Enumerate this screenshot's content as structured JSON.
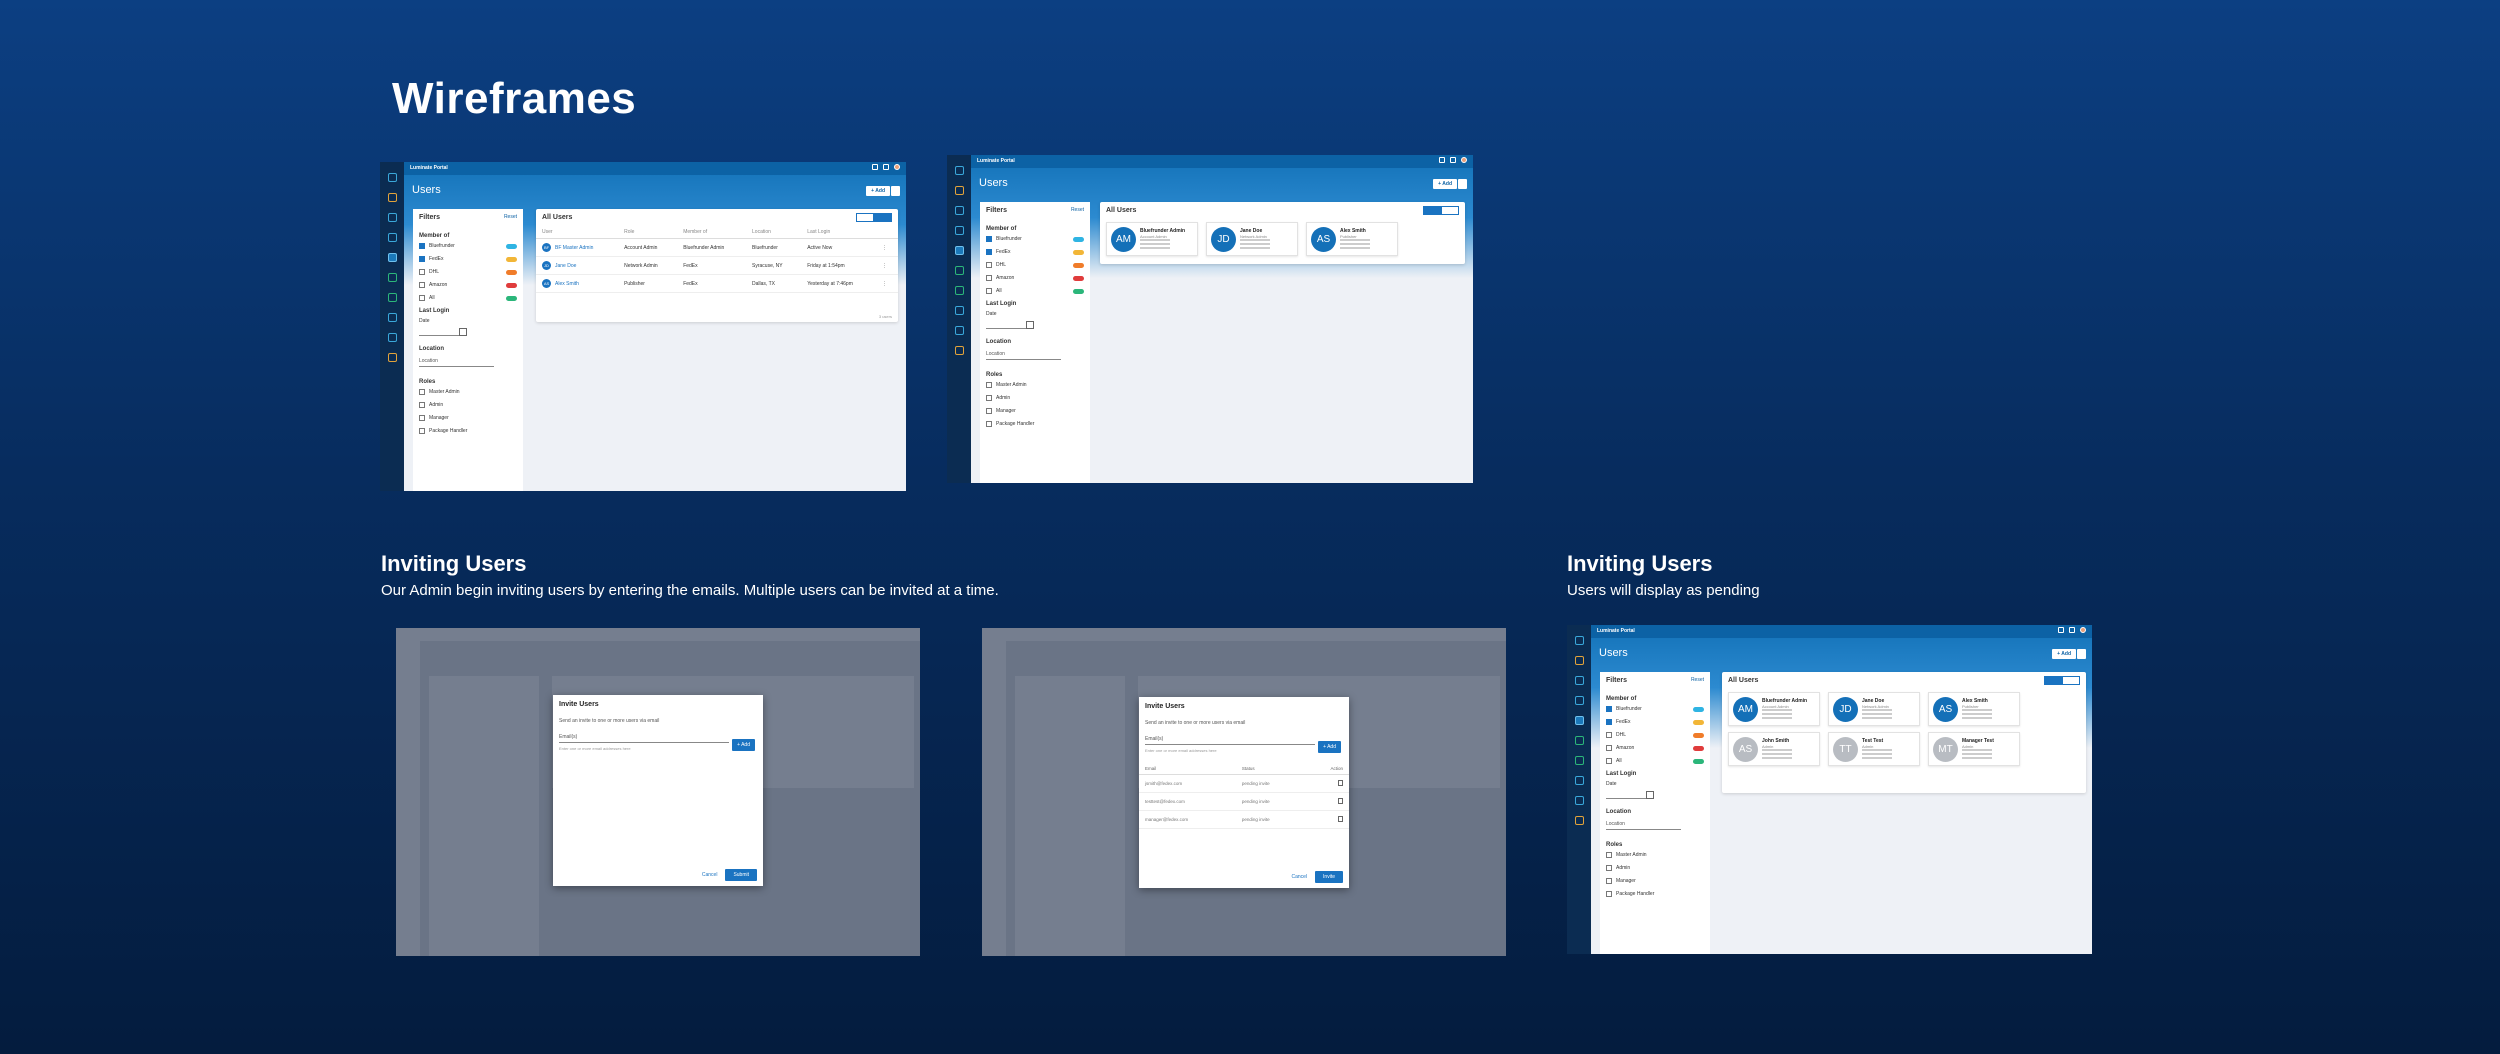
{
  "page": {
    "title": "Wireframes"
  },
  "sections": {
    "inviting_left": {
      "title": "Inviting Users",
      "subtitle": "Our Admin begin inviting users by entering the emails. Multiple users can be invited at a time."
    },
    "inviting_right": {
      "title": "Inviting Users",
      "subtitle": "Users will display as pending"
    }
  },
  "app": {
    "name": "Luminate Portal",
    "page_heading": "Users",
    "add_label": "+ Add",
    "filters": {
      "title": "Filters",
      "reset": "Reset",
      "member_of": "Member of",
      "members": [
        {
          "label": "Bluefrunder",
          "checked": true,
          "color": "#2fb4e3"
        },
        {
          "label": "FedEx",
          "checked": true,
          "color": "#f2b637"
        },
        {
          "label": "DHL",
          "checked": false,
          "color": "#f07c2a"
        },
        {
          "label": "Amazon",
          "checked": false,
          "color": "#e03c3c"
        },
        {
          "label": "All",
          "checked": false,
          "color": "#2bb67a"
        }
      ],
      "last_login": "Last Login",
      "date_label": "Date",
      "location": "Location",
      "location_placeholder": "Location",
      "roles": "Roles",
      "role_items": [
        "Master Admin",
        "Admin",
        "Manager",
        "Package Handler"
      ]
    },
    "all_users": "All Users",
    "table": {
      "columns": [
        "User",
        "Role",
        "Member of",
        "Location",
        "Last Login"
      ],
      "rows": [
        {
          "initials": "BF",
          "user": "BF Master Admin",
          "role": "Account Admin",
          "member": "Bluefrunder Admin",
          "location": "Bluefrunder",
          "last": "Active Now"
        },
        {
          "initials": "JD",
          "user": "Jane Doe",
          "role": "Network Admin",
          "member": "FedEx",
          "location": "Syracuse, NY",
          "last": "Friday at 1:54pm"
        },
        {
          "initials": "AS",
          "user": "Alex Smith",
          "role": "Publisher",
          "member": "FedEx",
          "location": "Dallas, TX",
          "last": "Yesterday at 7:46pm"
        }
      ],
      "footer": "3 users"
    },
    "cards": [
      {
        "initials": "AM",
        "name": "Bluefrunder Admin",
        "role": "Account Admin",
        "pending": false
      },
      {
        "initials": "JD",
        "name": "Jane Doe",
        "role": "Network Admin",
        "pending": false
      },
      {
        "initials": "AS",
        "name": "Alex Smith",
        "role": "Publisher",
        "pending": false
      }
    ],
    "cards_pending": [
      {
        "initials": "AS",
        "name": "John Smith",
        "role": "Admin",
        "pending": true
      },
      {
        "initials": "TT",
        "name": "Test Test",
        "role": "Admin",
        "pending": true
      },
      {
        "initials": "MT",
        "name": "Manager Test",
        "role": "Admin",
        "pending": true
      }
    ]
  },
  "dialog": {
    "title": "Invite Users",
    "description": "Send an invite to one or more users via email",
    "email_label": "Email(s)",
    "hint": "Enter one or more email addresses here",
    "add": "+ Add",
    "cancel": "Cancel",
    "submit": "Submit",
    "invite": "Invite",
    "columns": [
      "Email",
      "Status",
      "Action"
    ],
    "rows": [
      {
        "email": "jsmith@fedex.com",
        "status": "pending invite"
      },
      {
        "email": "testtest@fedex.com",
        "status": "pending invite"
      },
      {
        "email": "manager@fedex.com",
        "status": "pending invite"
      }
    ]
  }
}
